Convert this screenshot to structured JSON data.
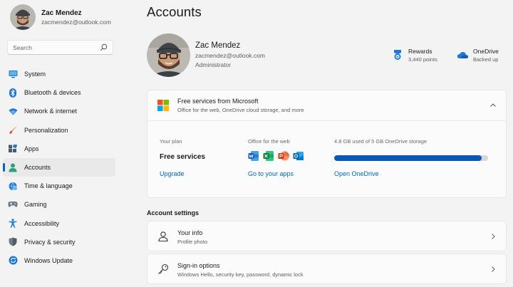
{
  "sidebar": {
    "user": {
      "name": "Zac Mendez",
      "email": "zacmendez@outlook.com"
    },
    "search": {
      "placeholder": "Search"
    },
    "items": [
      {
        "label": "System",
        "icon": "monitor-icon"
      },
      {
        "label": "Bluetooth & devices",
        "icon": "bluetooth-icon"
      },
      {
        "label": "Network & internet",
        "icon": "wifi-icon"
      },
      {
        "label": "Personalization",
        "icon": "brush-icon"
      },
      {
        "label": "Apps",
        "icon": "apps-icon"
      },
      {
        "label": "Accounts",
        "icon": "person-icon",
        "active": true
      },
      {
        "label": "Time & language",
        "icon": "globe-clock-icon"
      },
      {
        "label": "Gaming",
        "icon": "gamepad-icon"
      },
      {
        "label": "Accessibility",
        "icon": "accessibility-icon"
      },
      {
        "label": "Privacy & security",
        "icon": "shield-icon"
      },
      {
        "label": "Windows Update",
        "icon": "update-icon"
      }
    ]
  },
  "main": {
    "title": "Accounts",
    "profile": {
      "name": "Zac Mendez",
      "email": "zacmendez@outlook.com",
      "role": "Administrator"
    },
    "rewards": {
      "title": "Rewards",
      "subtitle": "3,440 points"
    },
    "onedrive": {
      "title": "OneDrive",
      "subtitle": "Backed up"
    },
    "ms_services": {
      "title": "Free services from Microsoft",
      "subtitle": "Office for the web, OneDrive cloud storage, and more",
      "plan_label": "Your plan",
      "plan_value": "Free services",
      "upgrade_link": "Upgrade",
      "office_label": "Office for the web",
      "office_link": "Go to your apps",
      "storage_label": "4.8 GB used of 5 GB OneDrive storage",
      "storage_fraction": 0.96,
      "storage_link": "Open OneDrive"
    },
    "account_settings": {
      "heading": "Account settings",
      "rows": [
        {
          "title": "Your info",
          "subtitle": "Profile photo"
        },
        {
          "title": "Sign-in options",
          "subtitle": "Windows Hello, security key, password, dynamic lock"
        }
      ]
    }
  },
  "colors": {
    "accent": "#0067c0",
    "background": "#f3f3f3",
    "card": "#fbfbfb",
    "storage_fill": "#0a58b4"
  }
}
